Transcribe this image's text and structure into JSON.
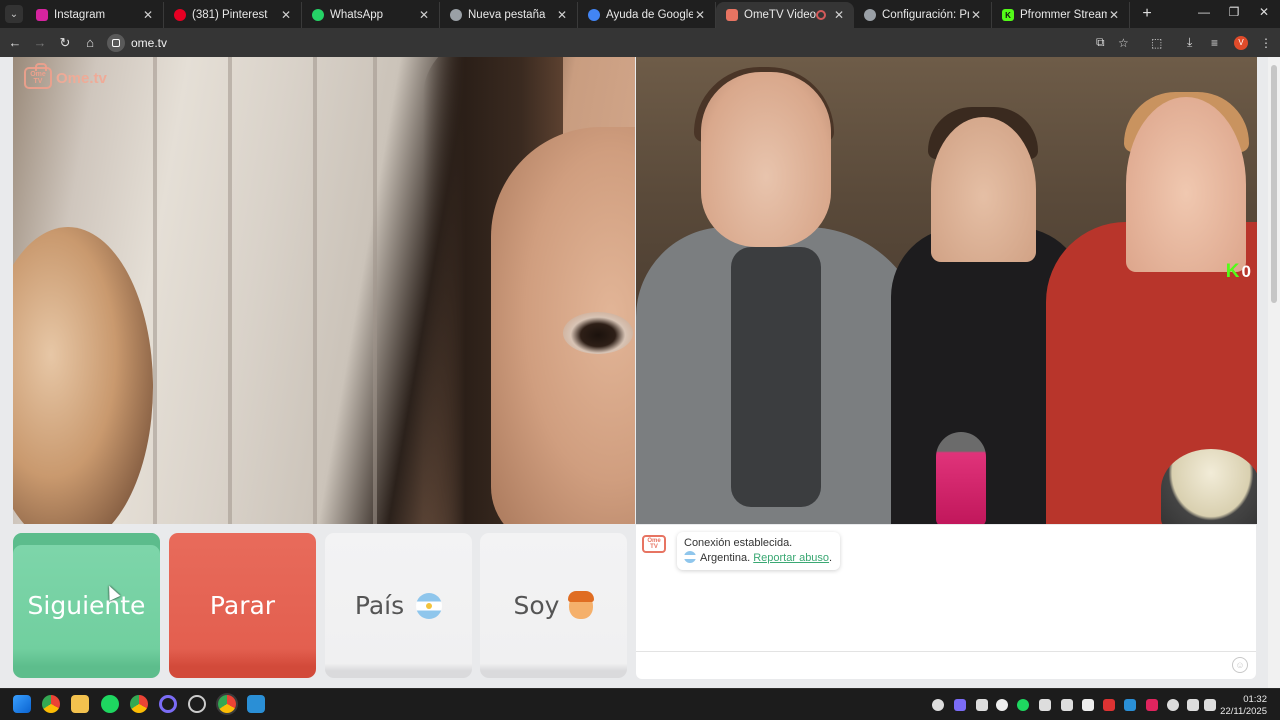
{
  "tabs": [
    {
      "title": "Instagram",
      "color": "#d6249f",
      "active": false
    },
    {
      "title": "(381) Pinterest",
      "color": "#e60023",
      "active": false
    },
    {
      "title": "WhatsApp",
      "color": "#25d366",
      "active": false
    },
    {
      "title": "Nueva pestaña",
      "color": "#9aa0a6",
      "active": false
    },
    {
      "title": "Ayuda de Google Chrome",
      "color": "#4285f4",
      "active": false
    },
    {
      "title": "OmeTV Video Chat -",
      "color": "#e77462",
      "active": true
    },
    {
      "title": "Configuración: Privacidad",
      "color": "#9aa0a6",
      "active": false
    },
    {
      "title": "Pfrommer Stream - Watch",
      "color": "#53fc18",
      "active": false
    }
  ],
  "toolbar": {
    "url": "ome.tv",
    "profile_initial": "V"
  },
  "logo": {
    "tv_text": "Ome TV",
    "name": "Ome.tv"
  },
  "stream_overlay": {
    "kick_letter": "K",
    "viewer_count": "0"
  },
  "buttons": {
    "next": "Siguiente",
    "stop": "Parar",
    "country": "País",
    "gender": "Soy"
  },
  "chat": {
    "logo_text": "Ome TV",
    "status": "Conexión establecida.",
    "country": "Argentina.",
    "report": "Reportar abuso",
    "report_suffix": "."
  },
  "taskbar": {
    "time": "01:32",
    "date": "22/11/2025"
  },
  "colors": {
    "next": "#79d3a6",
    "stop": "#e35f4f",
    "accent": "#3aa873"
  }
}
